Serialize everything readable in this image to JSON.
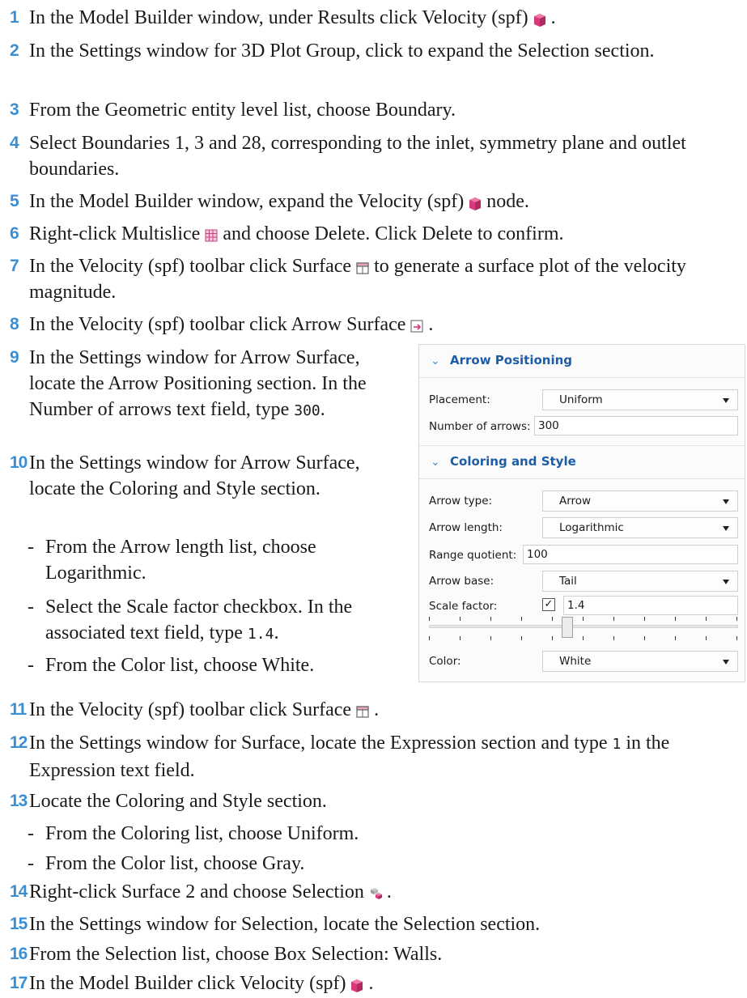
{
  "steps": [
    {
      "num": "1",
      "pre": "In the Model Builder window, under Results click Velocity (spf)",
      "post": ".",
      "icon": "plot-group-3d-icon"
    },
    {
      "num": "2",
      "text": "In the Settings window for 3D Plot Group, click to expand the Selection section."
    },
    {
      "num": "3",
      "text": "From the Geometric entity level list, choose Boundary."
    },
    {
      "num": "4",
      "text": "Select Boundaries 1, 3 and 28, corresponding to the inlet, symmetry plane and outlet boundaries."
    },
    {
      "num": "5",
      "pre": "In the Model Builder window, expand the Velocity (spf)",
      "post": "node.",
      "icon": "plot-group-3d-icon"
    },
    {
      "num": "6",
      "pre": "Right-click Multislice",
      "post": "and choose Delete. Click Delete to confirm.",
      "icon": "multislice-icon"
    },
    {
      "num": "7",
      "pre": "In the Velocity (spf) toolbar click Surface",
      "post": "to generate a surface plot of the velocity magnitude.",
      "icon": "surface-icon"
    },
    {
      "num": "8",
      "pre": "In the Velocity (spf) toolbar click Arrow Surface",
      "post": ".",
      "icon": "arrow-surface-icon"
    },
    {
      "num": "9",
      "pre": "In the Settings window for Arrow Surface, locate the Arrow Positioning section. In the Number of arrows text field, type",
      "code": "300",
      "post": "."
    },
    {
      "num": "10",
      "text": "In the Settings window for Arrow Surface, locate the Coloring and Style section."
    },
    {
      "num": "11",
      "pre": "In the Velocity (spf) toolbar click Surface",
      "post": ".",
      "icon": "surface-icon"
    },
    {
      "num": "12",
      "pre": "In the Settings window for Surface, locate the Expression section and type",
      "code": "1",
      "post": "in the Expression text field."
    },
    {
      "num": "13",
      "text": "Locate the Coloring and Style section."
    },
    {
      "num": "14",
      "pre": "Right-click Surface 2 and choose Selection",
      "post": ".",
      "icon": "selection-icon"
    },
    {
      "num": "15",
      "text": "In the Settings window for Selection, locate the Selection section."
    },
    {
      "num": "16",
      "text": "From the Selection list, choose Box Selection: Walls."
    },
    {
      "num": "17",
      "pre": "In the Model Builder click Velocity (spf)",
      "post": ".",
      "icon": "plot-group-3d-icon"
    }
  ],
  "bullets10": [
    {
      "text": "From the Arrow length list, choose Logarithmic."
    },
    {
      "pre": "Select the Scale factor checkbox. In the associated text field, type",
      "code": "1.4",
      "post": "."
    },
    {
      "text": "From the Color list, choose White."
    }
  ],
  "bullets13": [
    {
      "text": "From the Coloring list, choose Uniform."
    },
    {
      "text": "From the Color list, choose Gray."
    }
  ],
  "bullet_mark": "-",
  "panel": {
    "arrow_positioning": {
      "title": "Arrow Positioning",
      "placement_label": "Placement:",
      "placement_value": "Uniform",
      "number_label": "Number of arrows:",
      "number_value": "300"
    },
    "coloring_style": {
      "title": "Coloring and Style",
      "arrow_type_label": "Arrow type:",
      "arrow_type_value": "Arrow",
      "arrow_length_label": "Arrow length:",
      "arrow_length_value": "Logarithmic",
      "range_quotient_label": "Range quotient:",
      "range_quotient_value": "100",
      "arrow_base_label": "Arrow base:",
      "arrow_base_value": "Tail",
      "scale_factor_label": "Scale factor:",
      "scale_factor_checked": true,
      "scale_factor_value": "1.4",
      "color_label": "Color:",
      "color_value": "White"
    },
    "chevron": "⌄",
    "check_mark": "✓"
  },
  "colors": {
    "step_number": "#3a8fd4",
    "section_title": "#1c5da8",
    "icon_pink": "#d63a7a"
  }
}
